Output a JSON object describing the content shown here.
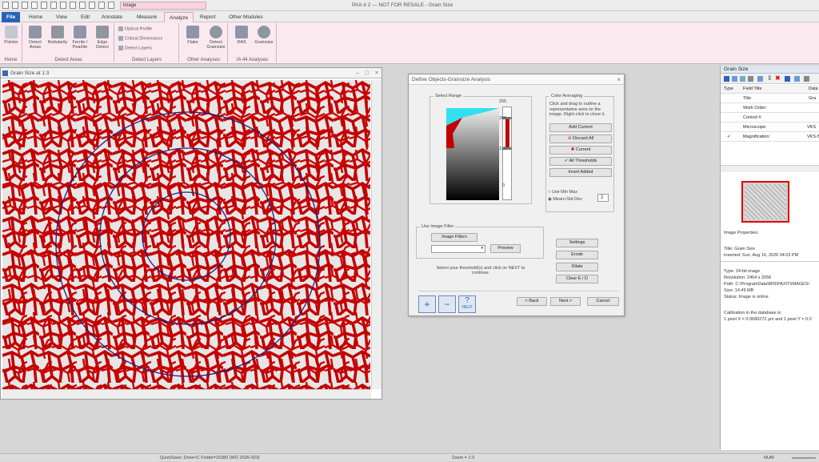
{
  "titlebar": {
    "search_value": "image",
    "window_title": "PAX-it 2 — NOT FOR RESALE - Grain Size"
  },
  "tabs": [
    "File",
    "Home",
    "View",
    "Edit",
    "Annotate",
    "Measure",
    "Analyze",
    "Report",
    "Other Modules"
  ],
  "ribbon": {
    "home": {
      "pointer": "Pointer",
      "label": "Home"
    },
    "detect_areas": {
      "label": "Detect Areas",
      "buttons": [
        "Detect Areas",
        "Nodularity",
        "Ferrite / Pearlite",
        "Edge Detect"
      ]
    },
    "detect_layers": {
      "label": "Detect Layers",
      "items": [
        "Optical Profile",
        "Critical Dimensions",
        "Detect Layers"
      ]
    },
    "other_analyses": {
      "label": "Other Analyses",
      "buttons": [
        "Flake",
        "Detect Grainsize"
      ]
    },
    "ia44": {
      "label": "IA 44 Analyses",
      "buttons": [
        "DAS",
        "Grainsize"
      ]
    }
  },
  "image_window": {
    "title": "Grain Size at 1:3"
  },
  "dialog": {
    "title": "Define Objects-Grainsize Analysis",
    "select_range": "Select Range",
    "range_ticks": [
      "255",
      "205",
      "115",
      "0"
    ],
    "color_averaging": {
      "label": "Color Averaging",
      "instructions": "Click and drag to outline a representative area on the image. Right-click to close it.",
      "buttons": [
        "Add Current",
        "Discard All",
        "Current",
        "All Thresholds",
        "Invert Added"
      ]
    },
    "use_min_max": "Use Min Max",
    "mean_std": "Mean+Std Dev",
    "std_value": "2",
    "use_image_filter": "Use Image Filter",
    "image_filters": "Image Filters",
    "preview": "Preview",
    "settings": "Settings",
    "erode": "Erode",
    "dilate": "Dilate",
    "clear": "Clear E / D",
    "instructions": "Select your threshold(s) and click on NEXT to continue.",
    "back": "< Back",
    "next": "Next >",
    "cancel": "Cancel",
    "help": "HELP"
  },
  "panel": {
    "title": "Grain Size",
    "headers": [
      "Type",
      "Field Title",
      "Data"
    ],
    "rows": [
      {
        "field": "Title",
        "data": "Gra"
      },
      {
        "field": "Work Order:",
        "data": ""
      },
      {
        "field": "Control #:",
        "data": ""
      },
      {
        "field": "Microscope:",
        "data": "VKS"
      },
      {
        "field": "Magnification:",
        "data": "VKS-5"
      }
    ],
    "image_properties": "Image Properties:",
    "title_line": "Title: Grain Size",
    "inserted": "Inserted: Sun, Aug 16, 2026 04:03 PM",
    "type": "Type: 24-bit image",
    "resolution": "Resolution: 2464 x 2056",
    "path": "Path: C:\\ProgramData\\MIS\\PAXIT\\IMAGES\\",
    "size": "Size: 14.49 MB",
    "status": "Status: Image is online",
    "calib": "Calibration in the database is:",
    "calib_value": "1 pixel X = 0.0680272 µm and 1 pixel Y = 0.0"
  },
  "statusbar": {
    "quicksave": "QuickSave: Drive=C Folder=15380 (WO 2026-023)",
    "zoom": "Zoom = 1:3",
    "num": "NUM"
  },
  "colors": {
    "accent": "#2a62b8",
    "threshold": "#cc0000",
    "ribbon": "#fbe9f0"
  }
}
